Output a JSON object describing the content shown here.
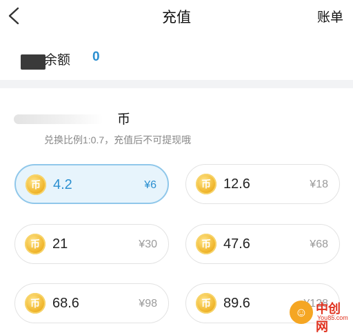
{
  "header": {
    "title": "充值",
    "bill_label": "账单",
    "back_icon": "chevron-left-icon"
  },
  "balance": {
    "label": "余额",
    "value": "0"
  },
  "section": {
    "unit": "币",
    "ratio_note": "兑换比例1:0.7，充值后不可提现哦"
  },
  "packages": [
    {
      "coin_glyph": "币",
      "amount": "4.2",
      "price": "¥6",
      "selected": true
    },
    {
      "coin_glyph": "币",
      "amount": "12.6",
      "price": "¥18",
      "selected": false
    },
    {
      "coin_glyph": "币",
      "amount": "21",
      "price": "¥30",
      "selected": false
    },
    {
      "coin_glyph": "币",
      "amount": "47.6",
      "price": "¥68",
      "selected": false
    },
    {
      "coin_glyph": "币",
      "amount": "68.6",
      "price": "¥98",
      "selected": false
    },
    {
      "coin_glyph": "币",
      "amount": "89.6",
      "price": "¥128",
      "selected": false
    }
  ],
  "watermark": {
    "logo_glyph": "☺",
    "text": "中创网",
    "sub": "You85.com"
  },
  "colors": {
    "accent": "#2b8fd0",
    "selected_bg": "#e7f4fc",
    "coin": "#f0b62d"
  }
}
